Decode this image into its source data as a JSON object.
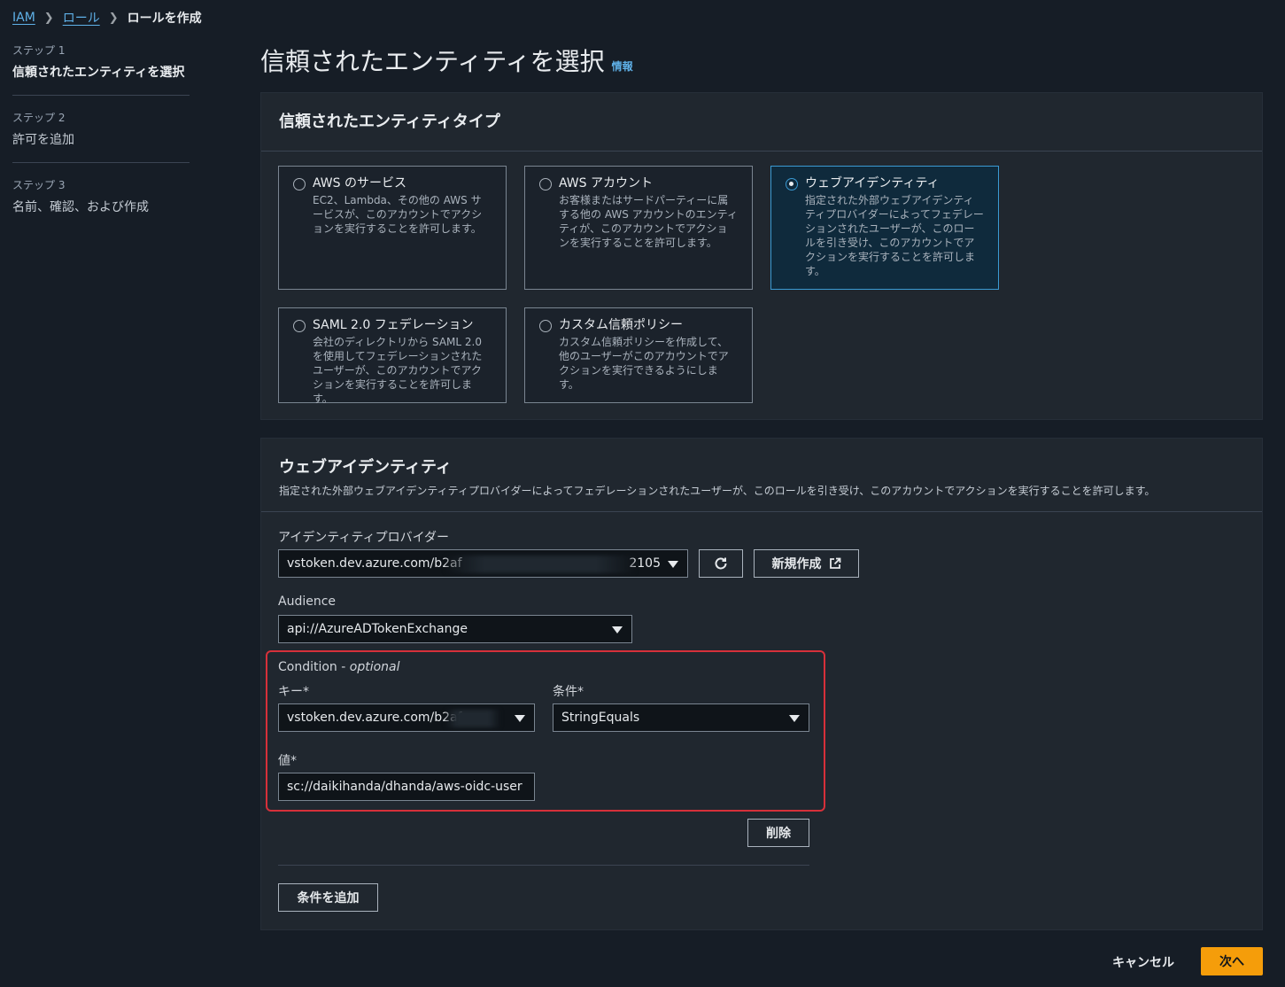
{
  "breadcrumb": {
    "items": [
      "IAM",
      "ロール"
    ],
    "current": "ロールを作成"
  },
  "steps": [
    {
      "num": "ステップ 1",
      "title": "信頼されたエンティティを選択"
    },
    {
      "num": "ステップ 2",
      "title": "許可を追加"
    },
    {
      "num": "ステップ 3",
      "title": "名前、確認、および作成"
    }
  ],
  "page": {
    "title": "信頼されたエンティティを選択",
    "info": "情報"
  },
  "entity_type": {
    "title": "信頼されたエンティティタイプ",
    "selected": "web-identity",
    "cards": [
      {
        "title": "AWS のサービス",
        "desc": "EC2、Lambda、その他の AWS サービスが、このアカウントでアクションを実行することを許可します。"
      },
      {
        "title": "AWS アカウント",
        "desc": "お客様またはサードパーティーに属する他の AWS アカウントのエンティティが、このアカウントでアクションを実行することを許可します。"
      },
      {
        "title": "ウェブアイデンティティ",
        "desc": "指定された外部ウェブアイデンティティプロバイダーによってフェデレーションされたユーザーが、このロールを引き受け、このアカウントでアクションを実行することを許可します。"
      },
      {
        "title": "SAML 2.0 フェデレーション",
        "desc": "会社のディレクトリから SAML 2.0 を使用してフェデレーションされたユーザーが、このアカウントでアクションを実行することを許可します。"
      },
      {
        "title": "カスタム信頼ポリシー",
        "desc": "カスタム信頼ポリシーを作成して、他のユーザーがこのアカウントでアクションを実行できるようにします。"
      }
    ]
  },
  "web_identity": {
    "title": "ウェブアイデンティティ",
    "desc": "指定された外部ウェブアイデンティティプロバイダーによってフェデレーションされたユーザーが、このロールを引き受け、このアカウントでアクションを実行することを許可します。",
    "provider_label": "アイデンティティプロバイダー",
    "provider_value_start": "vstoken.dev.azure.com/b2af",
    "provider_value_end": "2105",
    "create_new": "新規作成",
    "audience_label": "Audience",
    "audience_value": "api://AzureADTokenExchange",
    "condition_label": "Condition - ",
    "condition_optional": "optional",
    "key_label": "キー*",
    "key_value": "vstoken.dev.azure.com/b2af",
    "operator_label": "条件*",
    "operator_value": "StringEquals",
    "value_label": "値*",
    "value_value": "sc://daikihanda/dhanda/aws-oidc-user",
    "delete": "削除",
    "add_condition": "条件を追加"
  },
  "footer": {
    "cancel": "キャンセル",
    "next": "次へ"
  },
  "colors": {
    "accent": "#f59d0a",
    "link": "#5fb1e8",
    "selected_border": "#3a9ad3",
    "highlight": "#d6303a"
  }
}
